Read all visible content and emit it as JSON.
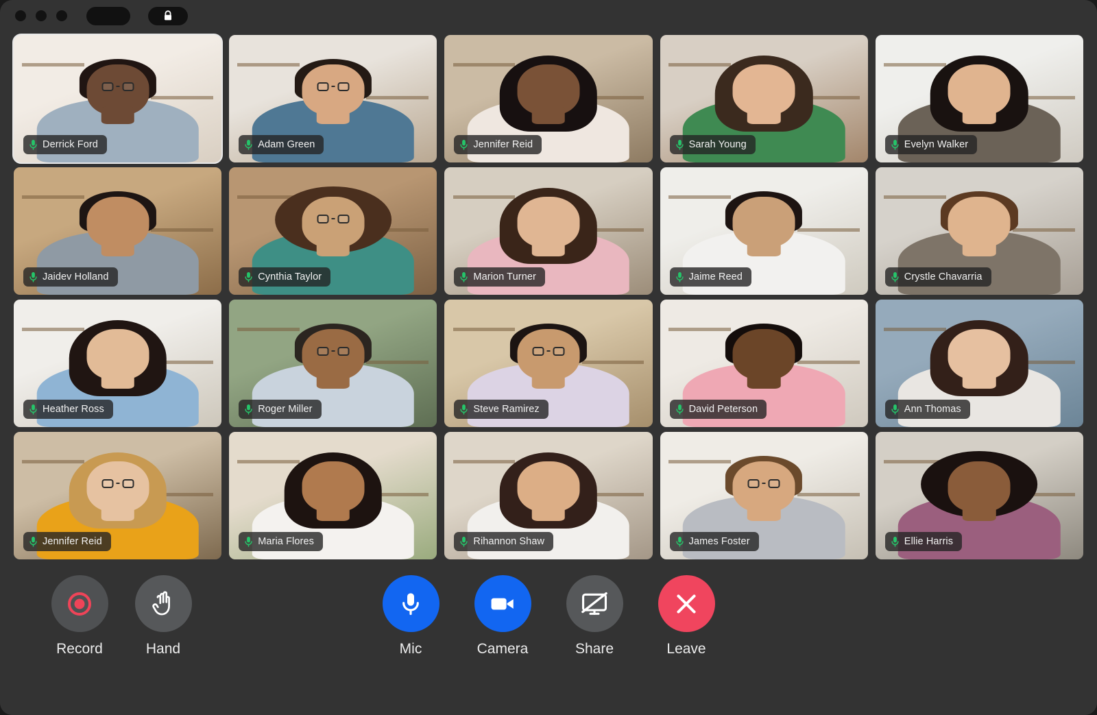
{
  "window": {
    "titlebar": {
      "traffic_lights": [
        "close",
        "minimize",
        "maximize"
      ],
      "blank_pill_label": "",
      "lock_pill_icon": "lock-icon"
    },
    "background_color": "#333333"
  },
  "colors": {
    "accent_blue": "#1266f1",
    "leave_red": "#f0455e",
    "neutral_gray": "#56585a",
    "record_red": "#e8394f",
    "mic_green": "#25c56a",
    "active_border": "#e8e8e8",
    "badge_bg": "rgba(36,36,36,0.80)"
  },
  "grid": {
    "columns": 5,
    "rows": 4,
    "participant_count": 20,
    "active_speaker_index": 0,
    "participants": [
      {
        "name": "Derrick Ford",
        "mic": "mic-on",
        "mic_icon": "microphone-icon",
        "active": true,
        "skin": "#6d4a35",
        "hair": "#201512",
        "shirt": "#9fb0bf",
        "bg1": "#f2ece5",
        "bg2": "#d9cfc2",
        "glasses": true,
        "hairstyle": "short"
      },
      {
        "name": "Adam Green",
        "mic": "mic-on",
        "mic_icon": "microphone-icon",
        "active": false,
        "skin": "#d8a882",
        "hair": "#241a14",
        "shirt": "#4f7894",
        "bg1": "#e8e3dc",
        "bg2": "#b9a892",
        "glasses": true,
        "hairstyle": "short"
      },
      {
        "name": "Jennifer Reid",
        "mic": "mic-on",
        "mic_icon": "microphone-icon",
        "active": false,
        "skin": "#7a5237",
        "hair": "#171010",
        "shirt": "#efe7e0",
        "bg1": "#cbbba4",
        "bg2": "#8e7b62",
        "glasses": false,
        "hairstyle": "long"
      },
      {
        "name": "Sarah Young",
        "mic": "mic-on",
        "mic_icon": "microphone-icon",
        "active": false,
        "skin": "#e3b693",
        "hair": "#3b2a1e",
        "shirt": "#3f8a52",
        "bg1": "#d8cfc4",
        "bg2": "#a3866b",
        "glasses": false,
        "hairstyle": "long"
      },
      {
        "name": "Evelyn Walker",
        "mic": "mic-on",
        "mic_icon": "microphone-icon",
        "active": false,
        "skin": "#e0b48f",
        "hair": "#191210",
        "shirt": "#6b6257",
        "bg1": "#efefec",
        "bg2": "#cfcac1",
        "glasses": false,
        "hairstyle": "long"
      },
      {
        "name": "Jaidev Holland",
        "mic": "mic-on",
        "mic_icon": "microphone-icon",
        "active": false,
        "skin": "#c08d62",
        "hair": "#1d1513",
        "shirt": "#8f9aa4",
        "bg1": "#c7a87f",
        "bg2": "#8c6d49",
        "glasses": false,
        "hairstyle": "short"
      },
      {
        "name": "Cynthia Taylor",
        "mic": "mic-on",
        "mic_icon": "microphone-icon",
        "active": false,
        "skin": "#caa176",
        "hair": "#4a2f1e",
        "shirt": "#3e8f85",
        "bg1": "#b89672",
        "bg2": "#7e6245",
        "glasses": true,
        "hairstyle": "curly"
      },
      {
        "name": "Marion Turner",
        "mic": "mic-on",
        "mic_icon": "microphone-icon",
        "active": false,
        "skin": "#e0b693",
        "hair": "#3a2519",
        "shirt": "#e9b7bf",
        "bg1": "#d6cec1",
        "bg2": "#9c8d79",
        "glasses": false,
        "hairstyle": "long"
      },
      {
        "name": "Jaime Reed",
        "mic": "mic-on",
        "mic_icon": "microphone-icon",
        "active": false,
        "skin": "#caa078",
        "hair": "#1d1412",
        "shirt": "#f2f1ef",
        "bg1": "#efeeea",
        "bg2": "#cfcabf",
        "glasses": false,
        "hairstyle": "short"
      },
      {
        "name": "Crystle Chavarria",
        "mic": "mic-on",
        "mic_icon": "microphone-icon",
        "active": false,
        "skin": "#dfb48e",
        "hair": "#5c3a22",
        "shirt": "#7e7468",
        "bg1": "#d6d2cb",
        "bg2": "#a8a096",
        "glasses": false,
        "hairstyle": "short"
      },
      {
        "name": "Heather Ross",
        "mic": "mic-on",
        "mic_icon": "microphone-icon",
        "active": false,
        "skin": "#e2bb97",
        "hair": "#201512",
        "shirt": "#8fb4d4",
        "bg1": "#f0eeea",
        "bg2": "#cdc7bb",
        "glasses": false,
        "hairstyle": "long"
      },
      {
        "name": "Roger Miller",
        "mic": "mic-on",
        "mic_icon": "microphone-icon",
        "active": false,
        "skin": "#9a6b44",
        "hair": "#2b2520",
        "shirt": "#c9d3dd",
        "bg1": "#92a583",
        "bg2": "#5e6e53",
        "glasses": true,
        "hairstyle": "short"
      },
      {
        "name": "Steve Ramirez",
        "mic": "mic-on",
        "mic_icon": "microphone-icon",
        "active": false,
        "skin": "#c89a6e",
        "hair": "#1c1412",
        "shirt": "#dcd3e4",
        "bg1": "#d8c7a8",
        "bg2": "#a68f6c",
        "glasses": true,
        "hairstyle": "short"
      },
      {
        "name": "David Peterson",
        "mic": "mic-on",
        "mic_icon": "microphone-icon",
        "active": false,
        "skin": "#6b4528",
        "hair": "#140d0b",
        "shirt": "#efa8b4",
        "bg1": "#eeeae4",
        "bg2": "#cfc9be",
        "glasses": false,
        "hairstyle": "short"
      },
      {
        "name": "Ann Thomas",
        "mic": "mic-on",
        "mic_icon": "microphone-icon",
        "active": false,
        "skin": "#e6c0a0",
        "hair": "#332019",
        "shirt": "#e9e6e2",
        "bg1": "#95aabb",
        "bg2": "#6c8597",
        "glasses": false,
        "hairstyle": "long"
      },
      {
        "name": "Jennifer Reid",
        "mic": "mic-on",
        "mic_icon": "microphone-icon",
        "active": false,
        "skin": "#e6c2a1",
        "hair": "#c89a52",
        "shirt": "#e9a219",
        "bg1": "#cdbda5",
        "bg2": "#7e6a4f",
        "glasses": true,
        "hairstyle": "long"
      },
      {
        "name": "Maria Flores",
        "mic": "mic-on",
        "mic_icon": "microphone-icon",
        "active": false,
        "skin": "#b07a4e",
        "hair": "#1d1310",
        "shirt": "#f4f2ef",
        "bg1": "#e4dbcc",
        "bg2": "#9aab7e",
        "glasses": false,
        "hairstyle": "long"
      },
      {
        "name": "Rihannon Shaw",
        "mic": "mic-on",
        "mic_icon": "microphone-icon",
        "active": false,
        "skin": "#dcae86",
        "hair": "#33201a",
        "shirt": "#f2f0ed",
        "bg1": "#ded6c9",
        "bg2": "#a49787",
        "glasses": false,
        "hairstyle": "long"
      },
      {
        "name": "James Foster",
        "mic": "mic-on",
        "mic_icon": "microphone-icon",
        "active": false,
        "skin": "#d7a87f",
        "hair": "#6b4a2c",
        "shirt": "#b9bcc2",
        "bg1": "#efece6",
        "bg2": "#c6c0b4",
        "glasses": true,
        "hairstyle": "short"
      },
      {
        "name": "Ellie Harris",
        "mic": "mic-on",
        "mic_icon": "microphone-icon",
        "active": false,
        "skin": "#8a5c3a",
        "hair": "#1a110f",
        "shirt": "#9b5f7e",
        "bg1": "#d4cfc6",
        "bg2": "#8e897f",
        "glasses": false,
        "hairstyle": "curly"
      }
    ]
  },
  "controls": {
    "left": [
      {
        "id": "record",
        "label": "Record",
        "icon": "record-icon",
        "style": "record",
        "state": "idle"
      },
      {
        "id": "hand",
        "label": "Hand",
        "icon": "raised-hand-icon",
        "style": "gray",
        "state": "idle"
      }
    ],
    "center": [
      {
        "id": "mic",
        "label": "Mic",
        "icon": "microphone-icon",
        "style": "blue",
        "state": "on"
      },
      {
        "id": "camera",
        "label": "Camera",
        "icon": "video-camera-icon",
        "style": "blue",
        "state": "on"
      },
      {
        "id": "share",
        "label": "Share",
        "icon": "screen-share-off-icon",
        "style": "gray",
        "state": "off"
      },
      {
        "id": "leave",
        "label": "Leave",
        "icon": "close-x-icon",
        "style": "red",
        "state": "idle"
      }
    ]
  }
}
